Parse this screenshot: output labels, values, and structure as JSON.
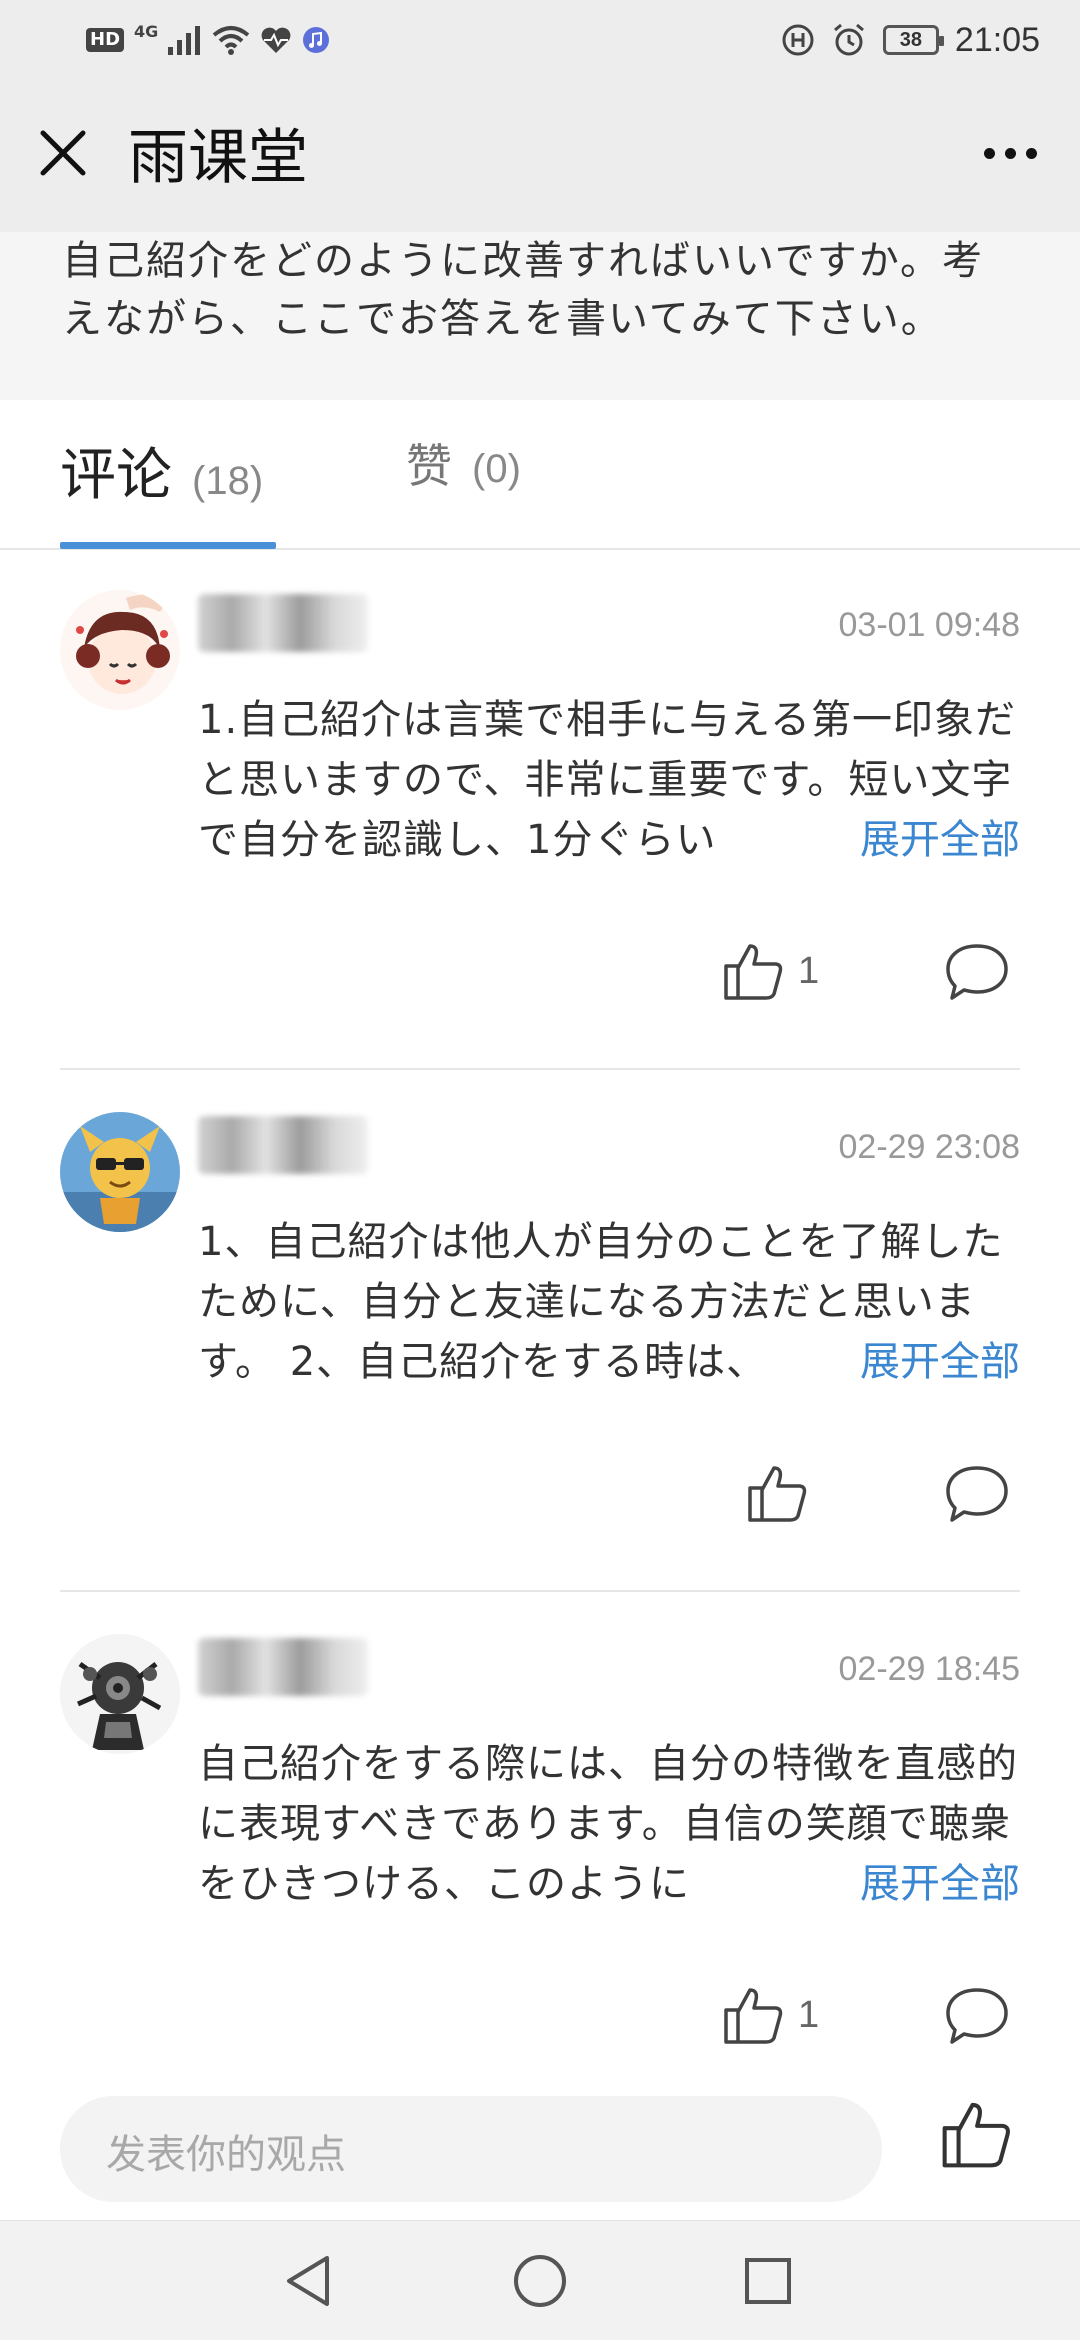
{
  "status_bar": {
    "hd": "HD",
    "network": "4G",
    "battery": "38",
    "time": "21:05"
  },
  "app": {
    "title": "雨课堂"
  },
  "question": {
    "text": "自己紹介をどのように改善すればいいですか。考えながら、ここでお答えを書いてみて下さい。"
  },
  "tabs": [
    {
      "label": "评论",
      "count": "(18)",
      "active": true
    },
    {
      "label": "赞",
      "count": "(0)",
      "active": false
    }
  ],
  "comments": [
    {
      "time": "03-01 09:48",
      "text": "1.自己紹介は言葉で相手に与える第一印象だと思いますので、非常に重要です。短い文字で自分を認識し、1分ぐらい",
      "expand": "展开全部",
      "likes": "1"
    },
    {
      "time": "02-29 23:08",
      "text": "1、自己紹介は他人が自分のことを了解したために、自分と友達になる方法だと思います。 2、自己紹介をする時は、",
      "expand": "展开全部",
      "likes": ""
    },
    {
      "time": "02-29 18:45",
      "text": "自己紹介をする際には、自分の特徴を直感的に表現すべきであります。自信の笑顔で聴衆をひきつける、このように",
      "expand": "展开全部",
      "likes": "1"
    }
  ],
  "compose": {
    "placeholder": "发表你的观点"
  },
  "icons": {
    "close": "close-icon",
    "more": "more-icon",
    "like": "thumbs-up-icon",
    "reply": "comment-bubble-icon",
    "back": "back-triangle-icon",
    "home": "home-circle-icon",
    "recents": "recents-square-icon"
  },
  "colors": {
    "accent": "#4a90d9",
    "link": "#3a86d0",
    "header_bg": "#ededed"
  }
}
